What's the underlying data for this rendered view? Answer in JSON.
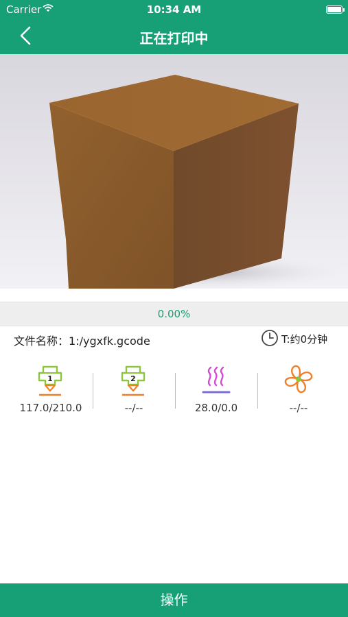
{
  "status_bar": {
    "carrier": "Carrier",
    "time": "10:34 AM"
  },
  "header": {
    "title": "正在打印中",
    "back_icon": "chevron-left-icon"
  },
  "preview": {
    "subject": "3d-model-cube-preview",
    "colors": {
      "cube": "#8a5a2e",
      "background": "#e6e4ea"
    }
  },
  "progress": {
    "label": "0.00%",
    "value": 0.0
  },
  "file": {
    "label": "文件名称：",
    "name": "1:/ygxfk.gcode"
  },
  "eta": {
    "icon": "clock-icon",
    "text": "T:约0分钟"
  },
  "stats": [
    {
      "icon": "extruder-1-icon",
      "value": "117.0/210.0"
    },
    {
      "icon": "extruder-2-icon",
      "value": "--/--"
    },
    {
      "icon": "heated-bed-icon",
      "value": "28.0/0.0"
    },
    {
      "icon": "fan-icon",
      "value": "--/--"
    }
  ],
  "footer": {
    "label": "操作"
  },
  "colors": {
    "primary": "#17a075",
    "extruder": "#8cc63f",
    "nozzle": "#f07f2a",
    "heat": "#d54bd8",
    "fan": "#f07f2a"
  }
}
